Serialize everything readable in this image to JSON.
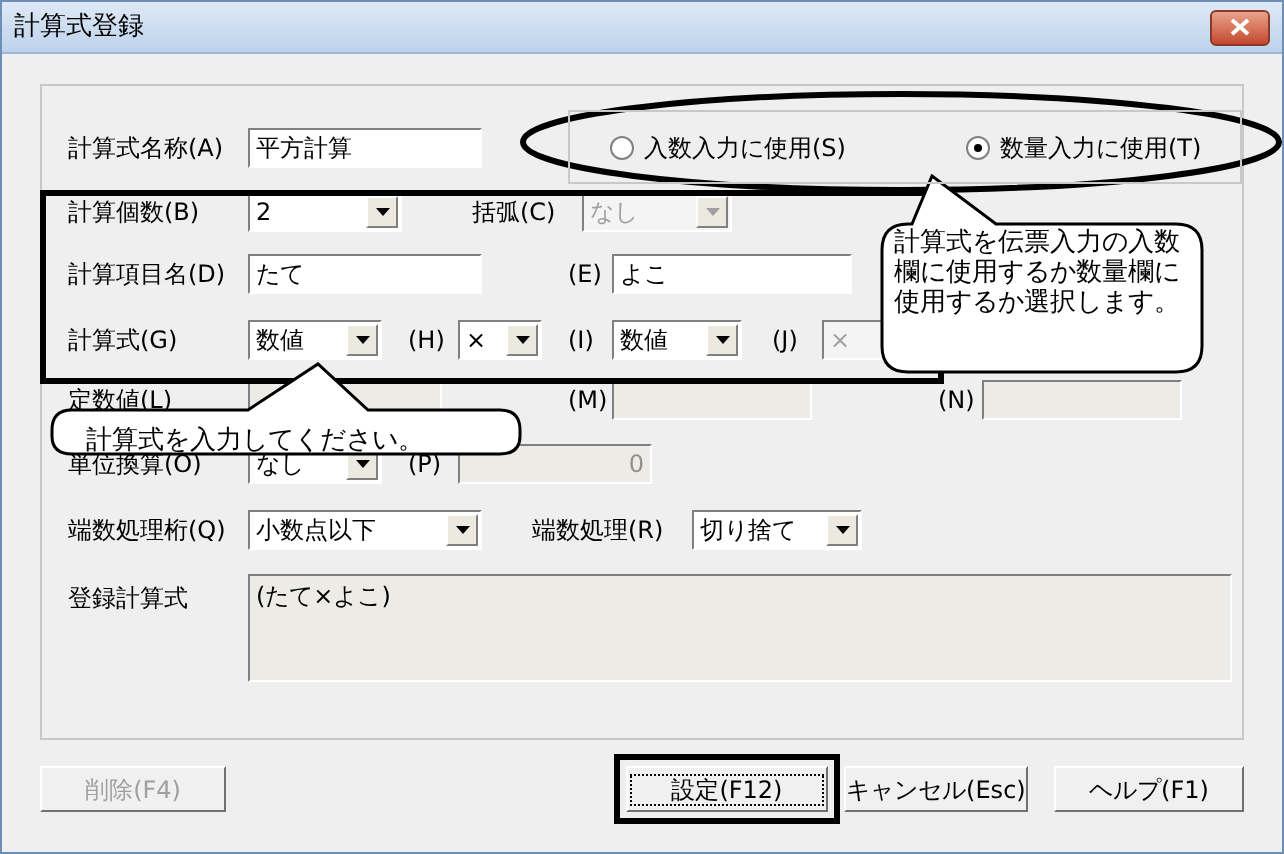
{
  "window": {
    "title": "計算式登録"
  },
  "formula_name": {
    "label": "計算式名称(A)",
    "value": "平方計算"
  },
  "usage_options": [
    {
      "label": "入数入力に使用(S)",
      "selected": false
    },
    {
      "label": "数量入力に使用(T)",
      "selected": true
    }
  ],
  "count": {
    "label": "計算個数(B)",
    "value": "2"
  },
  "bracket": {
    "label": "括弧(C)",
    "value": "なし",
    "disabled": true
  },
  "item_names": {
    "label": "計算項目名(D)",
    "value": "たて",
    "label_2": "(E)",
    "value_2": "よこ"
  },
  "formula": {
    "label": "計算式(G)",
    "value_1": "数値",
    "label_h": "(H)",
    "operator_1": "×",
    "label_i": "(I)",
    "value_2": "数値",
    "label_j": "(J)",
    "operator_2": "×",
    "operator_2_disabled": true
  },
  "constant": {
    "label": "定数値(L)",
    "label_m": "(M)",
    "label_n": "(N)"
  },
  "unit_conversion": {
    "label": "単位換算(O)",
    "value": "なし",
    "label_p": "(P)",
    "value_p": "0"
  },
  "rounding": {
    "digit_label": "端数処理桁(Q)",
    "digit_value": "小数点以下",
    "method_label": "端数処理(R)",
    "method_value": "切り捨て"
  },
  "registered": {
    "label": "登録計算式",
    "value": "(たて×よこ)"
  },
  "buttons": [
    {
      "label": "削除(F4)",
      "disabled": true,
      "focused": false
    },
    {
      "label": "設定(F12)",
      "disabled": false,
      "focused": true
    },
    {
      "label": "キャンセル(Esc)",
      "disabled": false,
      "focused": false
    },
    {
      "label": "ヘルプ(F1)",
      "disabled": false,
      "focused": false
    }
  ],
  "callouts": [
    {
      "text": "計算式を伝票入力の入数欄に使用するか数量欄に使用するか選択します。"
    },
    {
      "text": "計算式を入力してください。"
    }
  ]
}
